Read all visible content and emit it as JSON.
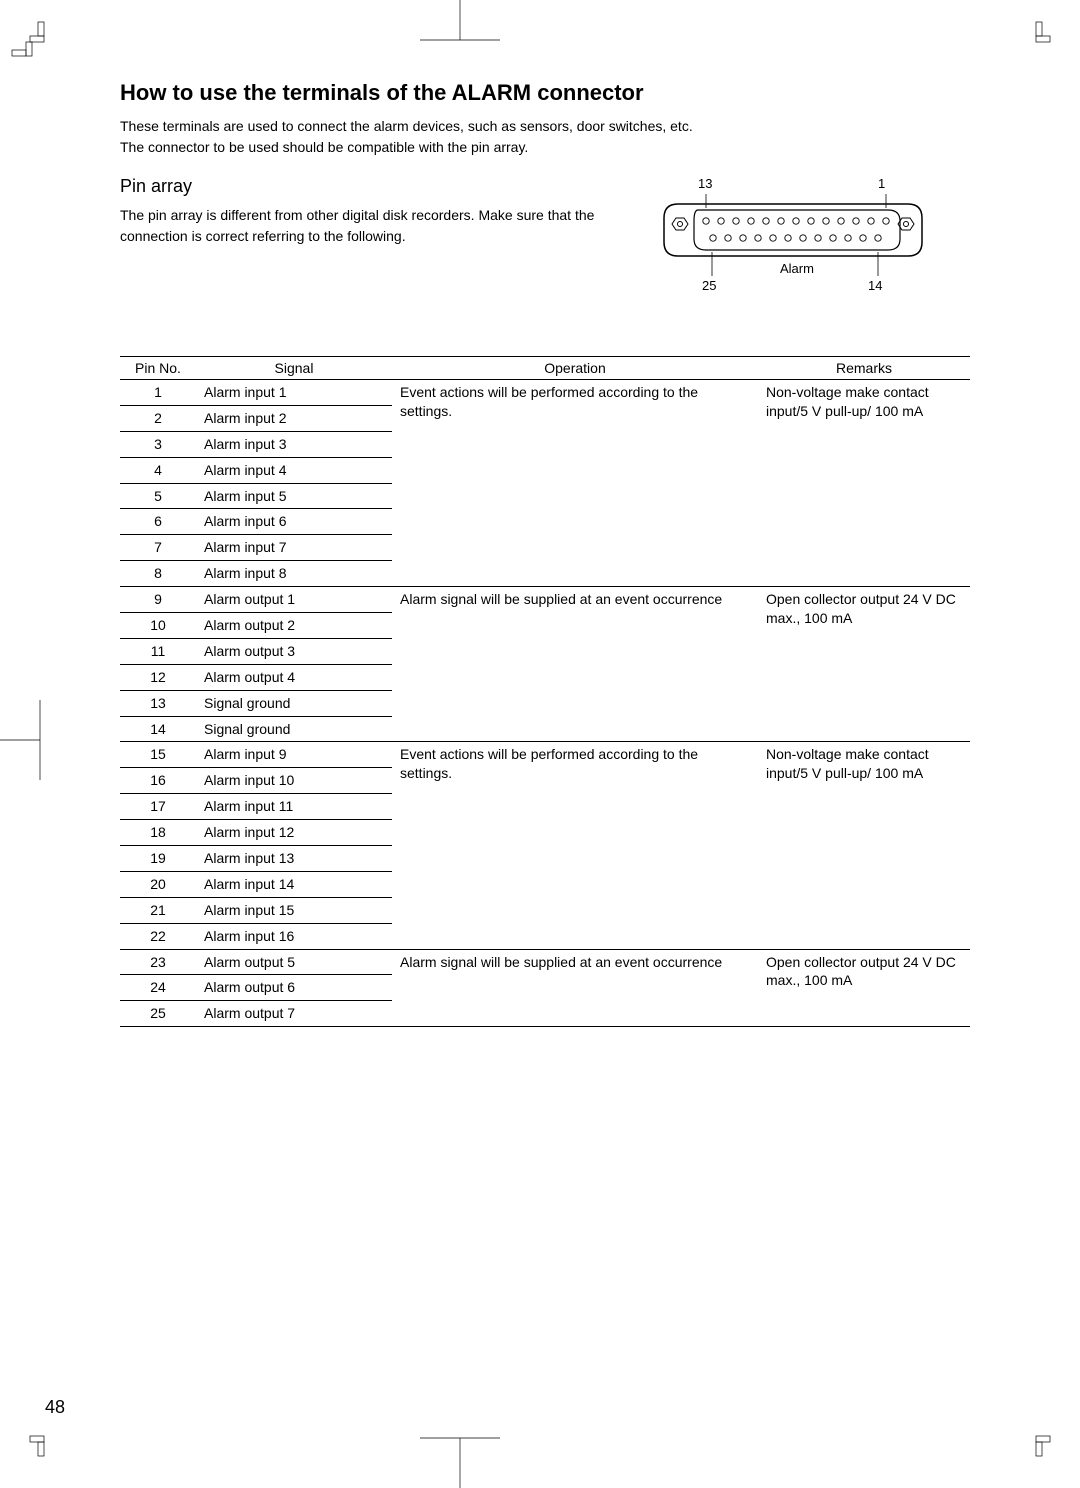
{
  "heading": "How to use the terminals of the ALARM connector",
  "intro_line1": "These terminals are used to connect the alarm devices, such as sensors, door switches, etc.",
  "intro_line2": "The connector to be used should be compatible with the pin array.",
  "subheading": "Pin array",
  "subtext": "The pin array is different from other digital disk recorders. Make sure that the connection is correct referring to the following.",
  "diagram": {
    "top_left": "13",
    "top_right": "1",
    "bottom_left": "25",
    "bottom_right": "14",
    "label": "Alarm"
  },
  "table": {
    "headers": {
      "pin_no": "Pin No.",
      "signal": "Signal",
      "operation": "Operation",
      "remarks": "Remarks"
    },
    "groups": [
      {
        "operation": "Event actions will be performed according to the settings.",
        "remarks": "Non-voltage make contact input/5 V pull-up/ 100 mA",
        "rows": [
          {
            "pin": "1",
            "signal": "Alarm input 1"
          },
          {
            "pin": "2",
            "signal": "Alarm input 2"
          },
          {
            "pin": "3",
            "signal": "Alarm input 3"
          },
          {
            "pin": "4",
            "signal": "Alarm input 4"
          },
          {
            "pin": "5",
            "signal": "Alarm input 5"
          },
          {
            "pin": "6",
            "signal": "Alarm input 6"
          },
          {
            "pin": "7",
            "signal": "Alarm input 7"
          },
          {
            "pin": "8",
            "signal": "Alarm input 8"
          }
        ]
      },
      {
        "operation": "Alarm signal will be supplied at an event occurrence",
        "remarks": "Open collector output 24 V DC max.,  100 mA",
        "rows": [
          {
            "pin": "9",
            "signal": "Alarm output 1"
          },
          {
            "pin": "10",
            "signal": "Alarm output 2"
          },
          {
            "pin": "11",
            "signal": "Alarm output 3"
          },
          {
            "pin": "12",
            "signal": "Alarm output 4"
          },
          {
            "pin": "13",
            "signal": "Signal ground"
          },
          {
            "pin": "14",
            "signal": "Signal ground"
          }
        ]
      },
      {
        "operation": "Event actions will be performed according to the settings.",
        "remarks": "Non-voltage make contact input/5 V pull-up/ 100 mA",
        "rows": [
          {
            "pin": "15",
            "signal": "Alarm input 9"
          },
          {
            "pin": "16",
            "signal": "Alarm input 10"
          },
          {
            "pin": "17",
            "signal": "Alarm input 11"
          },
          {
            "pin": "18",
            "signal": "Alarm input 12"
          },
          {
            "pin": "19",
            "signal": "Alarm input 13"
          },
          {
            "pin": "20",
            "signal": "Alarm input 14"
          },
          {
            "pin": "21",
            "signal": "Alarm input 15"
          },
          {
            "pin": "22",
            "signal": "Alarm input 16"
          }
        ]
      },
      {
        "operation": "Alarm signal will be supplied at an event occurrence",
        "remarks": "Open collector output 24 V DC max.,  100 mA",
        "rows": [
          {
            "pin": "23",
            "signal": "Alarm output 5"
          },
          {
            "pin": "24",
            "signal": "Alarm output 6"
          },
          {
            "pin": "25",
            "signal": "Alarm output 7"
          }
        ]
      }
    ]
  },
  "page_number": "48"
}
